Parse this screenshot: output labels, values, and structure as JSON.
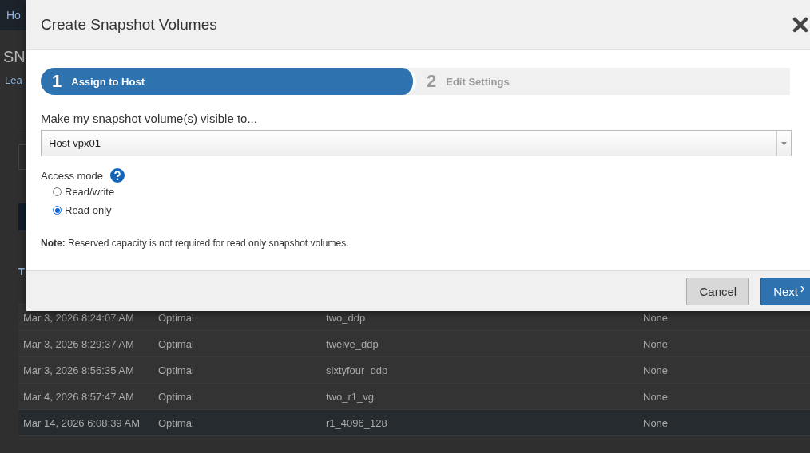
{
  "background_page": {
    "breadcrumb": "Ho",
    "heading": "SN",
    "link": "Lea",
    "table": {
      "header": "T",
      "rows": [
        {
          "cells": [
            "Mar 3, 2026 8:24:07 AM",
            "Optimal",
            "two_ddp",
            "None"
          ],
          "selected": false
        },
        {
          "cells": [
            "Mar 3, 2026 8:29:37 AM",
            "Optimal",
            "twelve_ddp",
            "None"
          ],
          "selected": false
        },
        {
          "cells": [
            "Mar 3, 2026 8:56:35 AM",
            "Optimal",
            "sixtyfour_ddp",
            "None"
          ],
          "selected": false
        },
        {
          "cells": [
            "Mar 4, 2026 8:57:47 AM",
            "Optimal",
            "two_r1_vg",
            "None"
          ],
          "selected": false
        },
        {
          "cells": [
            "Mar 14, 2026 6:08:39 AM",
            "Optimal",
            "r1_4096_128",
            "None"
          ],
          "selected": true
        }
      ]
    }
  },
  "dialog": {
    "title": "Create Snapshot Volumes",
    "steps": [
      {
        "number": "1",
        "label": "Assign to Host",
        "selected": true
      },
      {
        "number": "2",
        "label": "Edit Settings",
        "selected": false
      }
    ],
    "host_label": "Make my snapshot volume(s) visible to...",
    "host_select": {
      "value": "Host vpx01"
    },
    "access_mode": {
      "label": "Access mode",
      "options": [
        {
          "label": "Read/write",
          "selected": false
        },
        {
          "label": "Read only",
          "selected": true
        }
      ]
    },
    "note": "**Note:** Reserved capacity is not required for read only snapshot volumes.",
    "buttons": [
      {
        "label": "Cancel",
        "kind": "secondary"
      },
      {
        "label": "Next",
        "kind": "primary"
      }
    ]
  }
}
